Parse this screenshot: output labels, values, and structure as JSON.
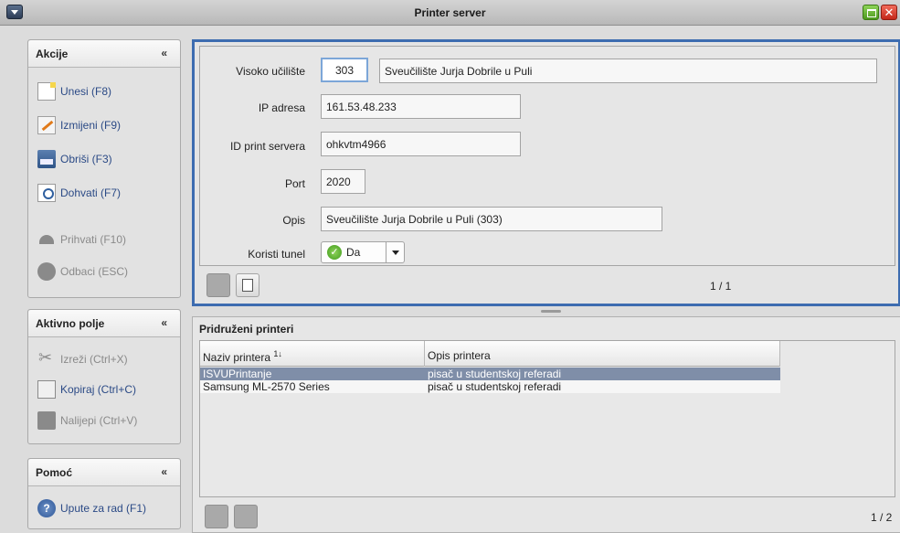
{
  "window": {
    "title": "Printer server"
  },
  "sidebar": {
    "akcije": {
      "title": "Akcije",
      "items": [
        {
          "label": "Unesi (F8)",
          "icon": "new-document-icon",
          "enabled": true
        },
        {
          "label": "Izmijeni (F9)",
          "icon": "edit-icon",
          "enabled": true
        },
        {
          "label": "Obriši (F3)",
          "icon": "printer-delete-icon",
          "enabled": true
        },
        {
          "label": "Dohvati (F7)",
          "icon": "search-icon",
          "enabled": true
        },
        {
          "label": "Prihvati (F10)",
          "icon": "accept-arrow-icon",
          "enabled": false
        },
        {
          "label": "Odbaci (ESC)",
          "icon": "cancel-icon",
          "enabled": false
        }
      ]
    },
    "aktivno_polje": {
      "title": "Aktivno polje",
      "items": [
        {
          "label": "Izreži (Ctrl+X)",
          "icon": "scissors-icon",
          "enabled": false
        },
        {
          "label": "Kopiraj (Ctrl+C)",
          "icon": "copy-icon",
          "enabled": true
        },
        {
          "label": "Nalijepi (Ctrl+V)",
          "icon": "paste-icon",
          "enabled": false
        }
      ]
    },
    "pomoc": {
      "title": "Pomoć",
      "items": [
        {
          "label": "Upute za rad (F1)",
          "icon": "help-icon",
          "enabled": true
        }
      ]
    }
  },
  "form": {
    "visoko_uciliste_label": "Visoko učilište",
    "visoko_uciliste_code": "303",
    "visoko_uciliste_name": "Sveučilište Jurja Dobrile u Puli",
    "ip_label": "IP adresa",
    "ip_value": "161.53.48.233",
    "id_label": "ID print servera",
    "id_value": "ohkvtm4966",
    "port_label": "Port",
    "port_value": "2020",
    "opis_label": "Opis",
    "opis_value": "Sveučilište Jurja Dobrile u Puli (303)",
    "tunel_label": "Koristi tunel",
    "tunel_value": "Da",
    "pager": "1 / 1"
  },
  "table": {
    "title": "Pridruženi printeri",
    "columns": [
      "Naziv printera",
      "Opis printera"
    ],
    "sort_indicator": "1↓",
    "rows": [
      {
        "naziv": "ISVUPrintanje",
        "opis": "pisač u studentskoj referadi",
        "selected": true
      },
      {
        "naziv": "Samsung ML-2570 Series",
        "opis": "pisač u studentskoj referadi",
        "selected": false
      }
    ],
    "pager": "1 / 2"
  },
  "colors": {
    "accent": "#3d6cb0",
    "selected_row": "#7f8ea8",
    "link": "#2b4a86"
  }
}
